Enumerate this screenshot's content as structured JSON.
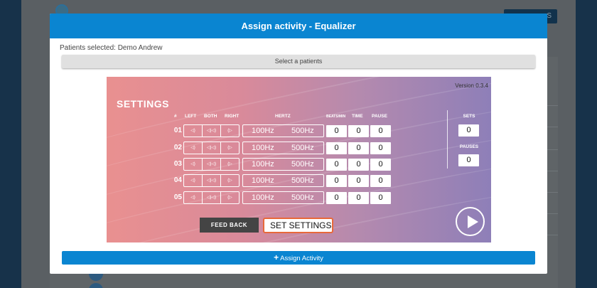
{
  "background": {
    "top_button_label": "S"
  },
  "modal": {
    "title": "Assign activity - Equalizer",
    "patients_selected": "Patients selected: Demo Andrew",
    "select_button": "Select a patients",
    "assign_button": "Assign Activity",
    "accent_color": "#0a85d1"
  },
  "game": {
    "version": "Version 0.3.4",
    "title": "SETTINGS",
    "headers": {
      "num": "#",
      "left": "LEFT",
      "both": "BOTH",
      "right": "RIGHT",
      "hertz": "HERTZ",
      "beats": "BEATS/MIN",
      "time": "TIME",
      "pause": "PAUSE"
    },
    "rows": [
      {
        "num": "01",
        "lo": "100Hz",
        "hi": "500Hz",
        "beats": "0",
        "time": "0",
        "pause": "0"
      },
      {
        "num": "02",
        "lo": "100Hz",
        "hi": "500Hz",
        "beats": "0",
        "time": "0",
        "pause": "0"
      },
      {
        "num": "03",
        "lo": "100Hz",
        "hi": "500Hz",
        "beats": "0",
        "time": "0",
        "pause": "0"
      },
      {
        "num": "04",
        "lo": "100Hz",
        "hi": "500Hz",
        "beats": "0",
        "time": "0",
        "pause": "0"
      },
      {
        "num": "05",
        "lo": "100Hz",
        "hi": "500Hz",
        "beats": "0",
        "time": "0",
        "pause": "0"
      }
    ],
    "sets_label": "SETS",
    "sets_value": "0",
    "pauses_label": "PAUSES",
    "pauses_value": "0",
    "feedback_button": "FEED BACK",
    "set_settings_button": "SET SETTINGS",
    "icons": {
      "channel": "speaker-icon",
      "play": "play-icon"
    }
  }
}
